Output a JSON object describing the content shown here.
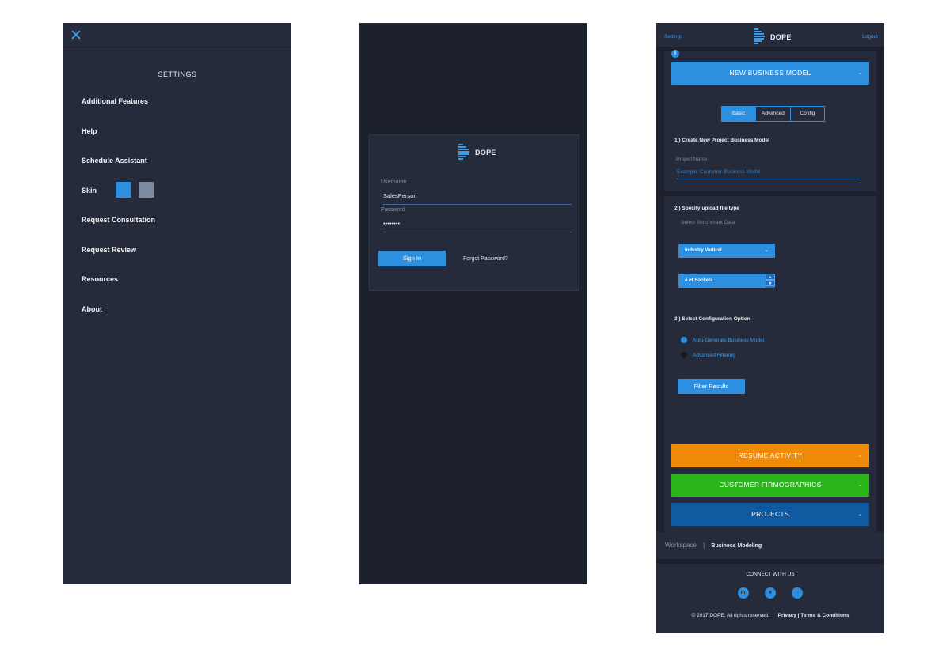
{
  "settings_panel": {
    "title": "SETTINGS",
    "items": [
      {
        "label": "Additional Features"
      },
      {
        "label": "Help"
      },
      {
        "label": "Schedule Assistant"
      },
      {
        "label": "Skin"
      },
      {
        "label": "Request Consultation"
      },
      {
        "label": "Request Review"
      },
      {
        "label": "Resources"
      },
      {
        "label": "About"
      }
    ],
    "skin_colors": [
      "#2d8fe0",
      "#7d8aa1"
    ]
  },
  "login": {
    "logo_text": "DOPE",
    "username_label": "Username",
    "username_value": "SalesPerson",
    "password_label": "Password",
    "password_value": "••••••••",
    "sign_in_label": "Sign In",
    "forgot_label": "Forgot Password?"
  },
  "business": {
    "header": {
      "settings_link": "Settings",
      "logo_text": "DOPE",
      "logout_link": "Logout"
    },
    "new_model": {
      "label": "NEW BUSINESS MODEL"
    },
    "tabs": [
      {
        "label": "Basic",
        "active": true
      },
      {
        "label": "Advanced"
      },
      {
        "label": "Config"
      }
    ],
    "step1": {
      "title": "1.) Create New Project Business Model",
      "field_label": "Project Name",
      "placeholder": "Example: Customer-Business-Model"
    },
    "step2": {
      "title": "2.) Specify upload file type",
      "subtitle": "Select Benchmark Data",
      "select1": "Industry Vertical",
      "select2": "# of Sockets"
    },
    "step3": {
      "title": "3.) Select Configuration Option",
      "options": [
        "Auto-Generate Business Model",
        "Advanced Filtering"
      ],
      "filter_button": "Filter Results"
    },
    "accordions": [
      {
        "label": "RESUME ACTIVITY",
        "color": "#f08b0a"
      },
      {
        "label": "CUSTOMER FIRMOGRAPHICS",
        "color": "#2ab51b"
      },
      {
        "label": "PROJECTS",
        "color": "#0f5aa0"
      }
    ],
    "breadcrumb": {
      "root": "Workspace",
      "separator": "|",
      "current": "Business Modeling"
    },
    "footer": {
      "connect": "CONNECT WITH US",
      "social": [
        "in",
        "#",
        "◌"
      ],
      "copyright": "© 2017 DOPE. All rights reserved.",
      "privacy": "Privacy",
      "separator": "|",
      "terms": "Terms & Conditions"
    }
  },
  "colors": {
    "accent": "#2d8fe0",
    "panel": "#252b3b",
    "bg": "#1c212d"
  }
}
